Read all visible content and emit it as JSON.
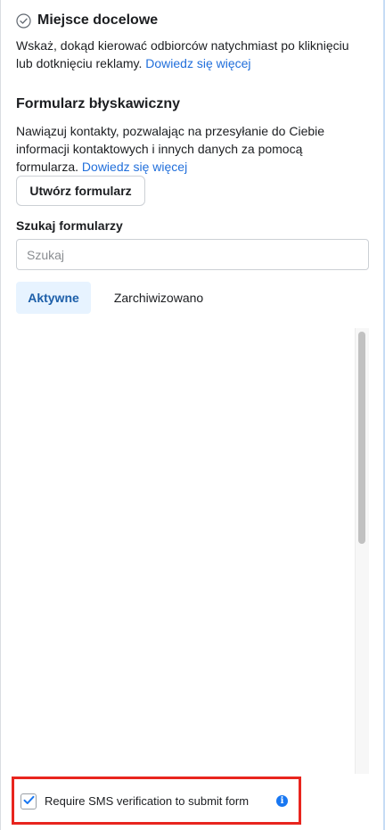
{
  "destination": {
    "title": "Miejsce docelowe",
    "description_line1": "Wskaż, dokąd kierować odbiorców natychmiast po kliknięciu",
    "description_line2": "lub dotknięciu reklamy.",
    "learn_more": "Dowiedz się więcej",
    "icon": "check-circle-icon"
  },
  "instant_form": {
    "title": "Formularz błyskawiczny",
    "description_line1": "Nawiązuj kontakty, pozwalając na przesyłanie do Ciebie",
    "description_line2": "informacji kontaktowych i innych danych za pomocą",
    "description_line3": "formularza.",
    "learn_more": "Dowiedz się więcej",
    "create_button": "Utwórz formularz"
  },
  "search": {
    "label": "Szukaj formularzy",
    "placeholder": "Szukaj",
    "value": ""
  },
  "tabs": [
    {
      "label": "Aktywne",
      "active": true
    },
    {
      "label": "Zarchiwizowano",
      "active": false
    }
  ],
  "sms_verification": {
    "label": "Require SMS verification to submit form",
    "checked": true,
    "info_icon": "info-icon"
  },
  "colors": {
    "link": "#216fdb",
    "tab_active_bg": "#e7f3ff",
    "tab_active_text": "#1d5fa9",
    "highlight_border": "#e8251e",
    "info_icon": "#1877f2"
  }
}
